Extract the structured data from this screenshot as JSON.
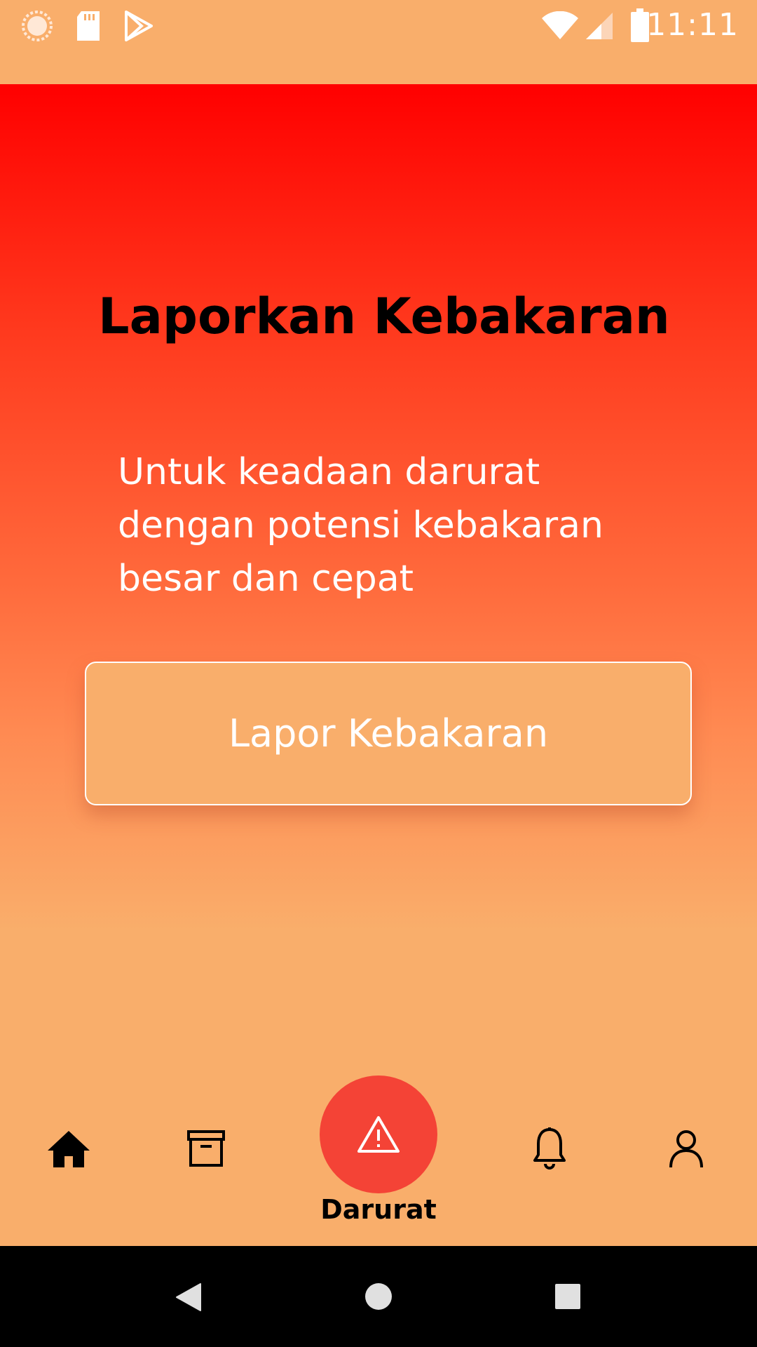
{
  "status_bar": {
    "time": "11:11",
    "icons": [
      "loading-circle-icon",
      "sd-card-icon",
      "play-store-icon",
      "wifi-icon",
      "signal-icon",
      "battery-icon"
    ]
  },
  "main": {
    "title": "Laporkan Kebakaran",
    "description": "Untuk keadaan darurat\ndengan potensi kebakaran\nbesar dan cepat",
    "report_button_label": "Lapor Kebakaran"
  },
  "bottom_nav": {
    "items": [
      {
        "icon": "home-icon"
      },
      {
        "icon": "archive-icon"
      },
      {
        "icon": "warning-icon",
        "label": "Darurat"
      },
      {
        "icon": "bell-icon"
      },
      {
        "icon": "profile-icon"
      }
    ]
  },
  "colors": {
    "status_bar_bg": "#F9AE6B",
    "gradient_top": "#FF0000",
    "gradient_bottom": "#F9AE6B",
    "fab_bg": "#F44336",
    "button_bg": "#F9AE6B",
    "system_nav_bg": "#000000"
  },
  "system_nav": {
    "buttons": [
      "back-icon",
      "home-circle-icon",
      "recents-icon"
    ]
  }
}
